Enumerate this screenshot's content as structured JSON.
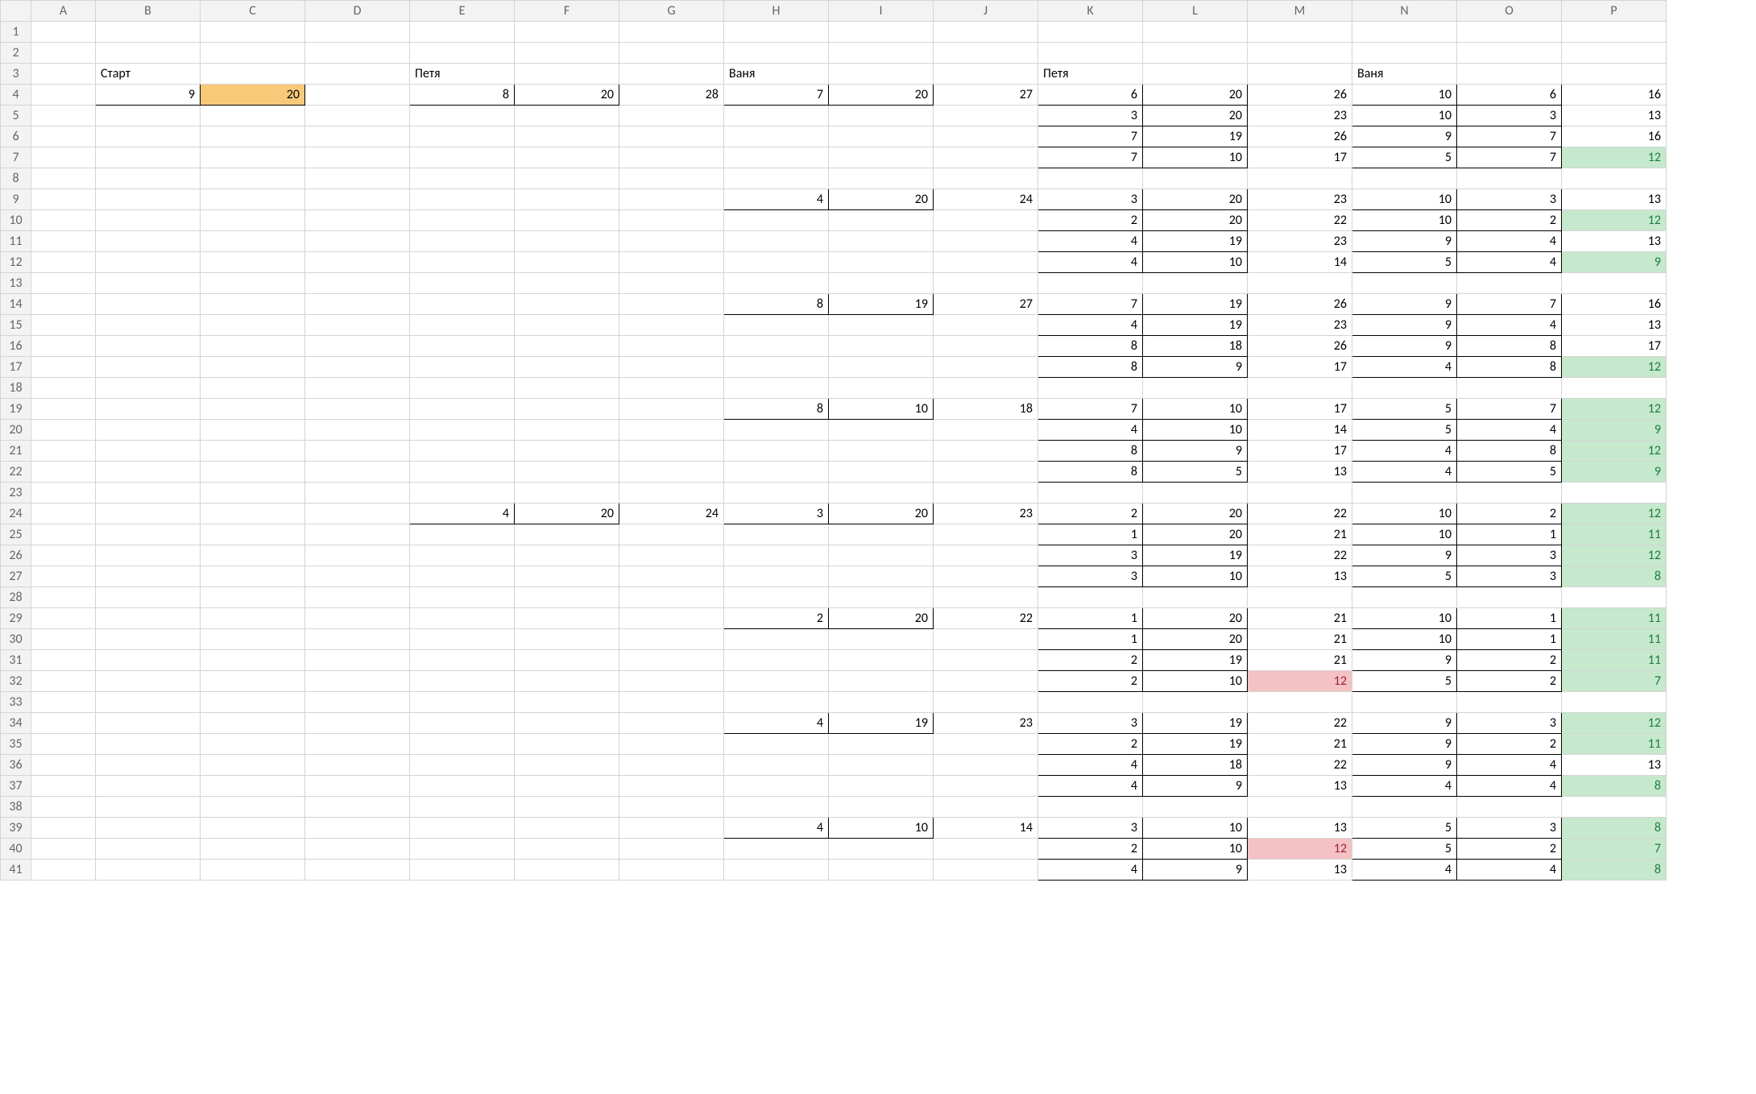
{
  "columns": [
    "A",
    "B",
    "C",
    "D",
    "E",
    "F",
    "G",
    "H",
    "I",
    "J",
    "K",
    "L",
    "M",
    "N",
    "O",
    "P"
  ],
  "col_widths": {
    "_hdr": 38,
    "A": 80,
    "B": 130,
    "C": 130,
    "D": 130,
    "E": 130,
    "F": 130,
    "G": 130,
    "H": 130,
    "I": 130,
    "J": 130,
    "K": 130,
    "L": 130,
    "M": 130,
    "N": 130,
    "O": 130,
    "P": 130
  },
  "row_count": 41,
  "labels": {
    "B3": "Старт",
    "E3": "Петя",
    "H3": "Ваня",
    "K3": "Петя",
    "N3": "Ваня"
  },
  "cells": {
    "B4": {
      "v": 9,
      "b": true
    },
    "C4": {
      "v": 20,
      "b": true,
      "fill": "orange"
    },
    "E4": {
      "v": 8,
      "b": true
    },
    "F4": {
      "v": 20,
      "b": true
    },
    "G4": {
      "v": 28
    },
    "E24": {
      "v": 4,
      "b": true
    },
    "F24": {
      "v": 20,
      "b": true
    },
    "G24": {
      "v": 24
    },
    "H4": {
      "v": 7,
      "b": true
    },
    "I4": {
      "v": 20,
      "b": true
    },
    "J4": {
      "v": 27
    },
    "H9": {
      "v": 4,
      "b": true
    },
    "I9": {
      "v": 20,
      "b": true
    },
    "J9": {
      "v": 24
    },
    "H14": {
      "v": 8,
      "b": true
    },
    "I14": {
      "v": 19,
      "b": true
    },
    "J14": {
      "v": 27
    },
    "H19": {
      "v": 8,
      "b": true
    },
    "I19": {
      "v": 10,
      "b": true
    },
    "J19": {
      "v": 18
    },
    "H24": {
      "v": 3,
      "b": true
    },
    "I24": {
      "v": 20,
      "b": true
    },
    "J24": {
      "v": 23
    },
    "H29": {
      "v": 2,
      "b": true
    },
    "I29": {
      "v": 20,
      "b": true
    },
    "J29": {
      "v": 22
    },
    "H34": {
      "v": 4,
      "b": true
    },
    "I34": {
      "v": 19,
      "b": true
    },
    "J34": {
      "v": 23
    },
    "H39": {
      "v": 4,
      "b": true
    },
    "I39": {
      "v": 10,
      "b": true
    },
    "J39": {
      "v": 14
    },
    "K4": {
      "v": 6,
      "b": true
    },
    "L4": {
      "v": 20,
      "b": true
    },
    "M4": {
      "v": 26
    },
    "N4": {
      "v": 10,
      "b": true
    },
    "O4": {
      "v": 6,
      "b": true
    },
    "P4": {
      "v": 16
    },
    "K5": {
      "v": 3,
      "b": true
    },
    "L5": {
      "v": 20,
      "b": true
    },
    "M5": {
      "v": 23
    },
    "N5": {
      "v": 10,
      "b": true
    },
    "O5": {
      "v": 3,
      "b": true
    },
    "P5": {
      "v": 13
    },
    "K6": {
      "v": 7,
      "b": true
    },
    "L6": {
      "v": 19,
      "b": true
    },
    "M6": {
      "v": 26
    },
    "N6": {
      "v": 9,
      "b": true
    },
    "O6": {
      "v": 7,
      "b": true
    },
    "P6": {
      "v": 16
    },
    "K7": {
      "v": 7,
      "b": true
    },
    "L7": {
      "v": 10,
      "b": true
    },
    "M7": {
      "v": 17
    },
    "N7": {
      "v": 5,
      "b": true
    },
    "O7": {
      "v": 7,
      "b": true
    },
    "P7": {
      "v": 12,
      "fill": "green",
      "state": "green"
    },
    "K9": {
      "v": 3,
      "b": true
    },
    "L9": {
      "v": 20,
      "b": true
    },
    "M9": {
      "v": 23
    },
    "N9": {
      "v": 10,
      "b": true
    },
    "O9": {
      "v": 3,
      "b": true
    },
    "P9": {
      "v": 13
    },
    "K10": {
      "v": 2,
      "b": true
    },
    "L10": {
      "v": 20,
      "b": true
    },
    "M10": {
      "v": 22
    },
    "N10": {
      "v": 10,
      "b": true
    },
    "O10": {
      "v": 2,
      "b": true
    },
    "P10": {
      "v": 12,
      "fill": "green",
      "state": "green"
    },
    "K11": {
      "v": 4,
      "b": true
    },
    "L11": {
      "v": 19,
      "b": true
    },
    "M11": {
      "v": 23
    },
    "N11": {
      "v": 9,
      "b": true
    },
    "O11": {
      "v": 4,
      "b": true
    },
    "P11": {
      "v": 13
    },
    "K12": {
      "v": 4,
      "b": true
    },
    "L12": {
      "v": 10,
      "b": true
    },
    "M12": {
      "v": 14
    },
    "N12": {
      "v": 5,
      "b": true
    },
    "O12": {
      "v": 4,
      "b": true
    },
    "P12": {
      "v": 9,
      "fill": "green",
      "state": "green"
    },
    "K14": {
      "v": 7,
      "b": true
    },
    "L14": {
      "v": 19,
      "b": true
    },
    "M14": {
      "v": 26
    },
    "N14": {
      "v": 9,
      "b": true
    },
    "O14": {
      "v": 7,
      "b": true
    },
    "P14": {
      "v": 16
    },
    "K15": {
      "v": 4,
      "b": true
    },
    "L15": {
      "v": 19,
      "b": true
    },
    "M15": {
      "v": 23
    },
    "N15": {
      "v": 9,
      "b": true
    },
    "O15": {
      "v": 4,
      "b": true
    },
    "P15": {
      "v": 13
    },
    "K16": {
      "v": 8,
      "b": true
    },
    "L16": {
      "v": 18,
      "b": true
    },
    "M16": {
      "v": 26
    },
    "N16": {
      "v": 9,
      "b": true
    },
    "O16": {
      "v": 8,
      "b": true
    },
    "P16": {
      "v": 17
    },
    "K17": {
      "v": 8,
      "b": true
    },
    "L17": {
      "v": 9,
      "b": true
    },
    "M17": {
      "v": 17
    },
    "N17": {
      "v": 4,
      "b": true
    },
    "O17": {
      "v": 8,
      "b": true
    },
    "P17": {
      "v": 12,
      "fill": "green",
      "state": "green"
    },
    "K19": {
      "v": 7,
      "b": true
    },
    "L19": {
      "v": 10,
      "b": true
    },
    "M19": {
      "v": 17
    },
    "N19": {
      "v": 5,
      "b": true
    },
    "O19": {
      "v": 7,
      "b": true
    },
    "P19": {
      "v": 12,
      "fill": "green",
      "state": "green"
    },
    "K20": {
      "v": 4,
      "b": true
    },
    "L20": {
      "v": 10,
      "b": true
    },
    "M20": {
      "v": 14
    },
    "N20": {
      "v": 5,
      "b": true
    },
    "O20": {
      "v": 4,
      "b": true
    },
    "P20": {
      "v": 9,
      "fill": "green",
      "state": "green"
    },
    "K21": {
      "v": 8,
      "b": true
    },
    "L21": {
      "v": 9,
      "b": true
    },
    "M21": {
      "v": 17
    },
    "N21": {
      "v": 4,
      "b": true
    },
    "O21": {
      "v": 8,
      "b": true
    },
    "P21": {
      "v": 12,
      "fill": "green",
      "state": "green"
    },
    "K22": {
      "v": 8,
      "b": true
    },
    "L22": {
      "v": 5,
      "b": true
    },
    "M22": {
      "v": 13
    },
    "N22": {
      "v": 4,
      "b": true
    },
    "O22": {
      "v": 5,
      "b": true
    },
    "P22": {
      "v": 9,
      "fill": "green",
      "state": "green"
    },
    "K24": {
      "v": 2,
      "b": true
    },
    "L24": {
      "v": 20,
      "b": true
    },
    "M24": {
      "v": 22
    },
    "N24": {
      "v": 10,
      "b": true
    },
    "O24": {
      "v": 2,
      "b": true
    },
    "P24": {
      "v": 12,
      "fill": "green",
      "state": "green"
    },
    "K25": {
      "v": 1,
      "b": true
    },
    "L25": {
      "v": 20,
      "b": true
    },
    "M25": {
      "v": 21
    },
    "N25": {
      "v": 10,
      "b": true
    },
    "O25": {
      "v": 1,
      "b": true
    },
    "P25": {
      "v": 11,
      "fill": "green",
      "state": "green"
    },
    "K26": {
      "v": 3,
      "b": true
    },
    "L26": {
      "v": 19,
      "b": true
    },
    "M26": {
      "v": 22
    },
    "N26": {
      "v": 9,
      "b": true
    },
    "O26": {
      "v": 3,
      "b": true
    },
    "P26": {
      "v": 12,
      "fill": "green",
      "state": "green"
    },
    "K27": {
      "v": 3,
      "b": true
    },
    "L27": {
      "v": 10,
      "b": true
    },
    "M27": {
      "v": 13
    },
    "N27": {
      "v": 5,
      "b": true
    },
    "O27": {
      "v": 3,
      "b": true
    },
    "P27": {
      "v": 8,
      "fill": "green",
      "state": "green"
    },
    "K29": {
      "v": 1,
      "b": true
    },
    "L29": {
      "v": 20,
      "b": true
    },
    "M29": {
      "v": 21
    },
    "N29": {
      "v": 10,
      "b": true
    },
    "O29": {
      "v": 1,
      "b": true
    },
    "P29": {
      "v": 11,
      "fill": "green",
      "state": "green"
    },
    "K30": {
      "v": 1,
      "b": true
    },
    "L30": {
      "v": 20,
      "b": true
    },
    "M30": {
      "v": 21
    },
    "N30": {
      "v": 10,
      "b": true
    },
    "O30": {
      "v": 1,
      "b": true
    },
    "P30": {
      "v": 11,
      "fill": "green",
      "state": "green"
    },
    "K31": {
      "v": 2,
      "b": true
    },
    "L31": {
      "v": 19,
      "b": true
    },
    "M31": {
      "v": 21
    },
    "N31": {
      "v": 9,
      "b": true
    },
    "O31": {
      "v": 2,
      "b": true
    },
    "P31": {
      "v": 11,
      "fill": "green",
      "state": "green"
    },
    "K32": {
      "v": 2,
      "b": true
    },
    "L32": {
      "v": 10,
      "b": true
    },
    "M32": {
      "v": 12,
      "fill": "red",
      "state": "red"
    },
    "N32": {
      "v": 5,
      "b": true
    },
    "O32": {
      "v": 2,
      "b": true
    },
    "P32": {
      "v": 7,
      "fill": "green",
      "state": "green"
    },
    "K34": {
      "v": 3,
      "b": true
    },
    "L34": {
      "v": 19,
      "b": true
    },
    "M34": {
      "v": 22
    },
    "N34": {
      "v": 9,
      "b": true
    },
    "O34": {
      "v": 3,
      "b": true
    },
    "P34": {
      "v": 12,
      "fill": "green",
      "state": "green"
    },
    "K35": {
      "v": 2,
      "b": true
    },
    "L35": {
      "v": 19,
      "b": true
    },
    "M35": {
      "v": 21
    },
    "N35": {
      "v": 9,
      "b": true
    },
    "O35": {
      "v": 2,
      "b": true
    },
    "P35": {
      "v": 11,
      "fill": "green",
      "state": "green"
    },
    "K36": {
      "v": 4,
      "b": true
    },
    "L36": {
      "v": 18,
      "b": true
    },
    "M36": {
      "v": 22
    },
    "N36": {
      "v": 9,
      "b": true
    },
    "O36": {
      "v": 4,
      "b": true
    },
    "P36": {
      "v": 13
    },
    "K37": {
      "v": 4,
      "b": true
    },
    "L37": {
      "v": 9,
      "b": true
    },
    "M37": {
      "v": 13
    },
    "N37": {
      "v": 4,
      "b": true
    },
    "O37": {
      "v": 4,
      "b": true
    },
    "P37": {
      "v": 8,
      "fill": "green",
      "state": "green"
    },
    "K39": {
      "v": 3,
      "b": true
    },
    "L39": {
      "v": 10,
      "b": true
    },
    "M39": {
      "v": 13
    },
    "N39": {
      "v": 5,
      "b": true
    },
    "O39": {
      "v": 3,
      "b": true
    },
    "P39": {
      "v": 8,
      "fill": "green",
      "state": "green"
    },
    "K40": {
      "v": 2,
      "b": true
    },
    "L40": {
      "v": 10,
      "b": true
    },
    "M40": {
      "v": 12,
      "fill": "red",
      "state": "red"
    },
    "N40": {
      "v": 5,
      "b": true
    },
    "O40": {
      "v": 2,
      "b": true
    },
    "P40": {
      "v": 7,
      "fill": "green",
      "state": "green"
    },
    "K41": {
      "v": 4,
      "b": true
    },
    "L41": {
      "v": 9,
      "b": true
    },
    "M41": {
      "v": 13
    },
    "N41": {
      "v": 4,
      "b": true
    },
    "O41": {
      "v": 4,
      "b": true
    },
    "P41": {
      "v": 8,
      "fill": "green",
      "state": "green"
    }
  }
}
